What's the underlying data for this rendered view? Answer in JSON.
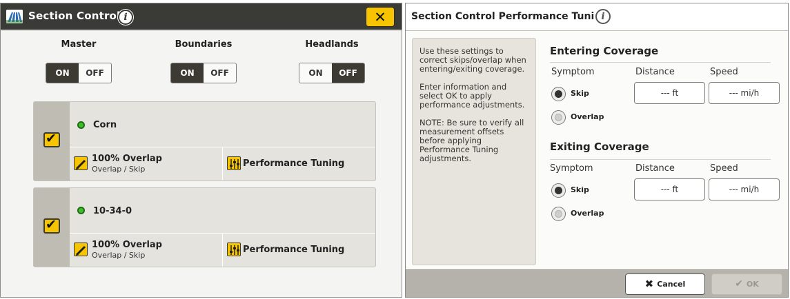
{
  "left": {
    "title": "Section Control",
    "close_icon": "close-icon",
    "toggles": [
      {
        "label": "Master",
        "on": "ON",
        "off": "OFF",
        "state": "on"
      },
      {
        "label": "Boundaries",
        "on": "ON",
        "off": "OFF",
        "state": "on"
      },
      {
        "label": "Headlands",
        "on": "ON",
        "off": "OFF",
        "state": "off"
      }
    ],
    "products": [
      {
        "name": "Corn",
        "checked": true,
        "status": "green",
        "overlap_title": "100% Overlap",
        "overlap_sub": "Overlap / Skip",
        "tuning_label": "Performance Tuning"
      },
      {
        "name": "10-34-0",
        "checked": true,
        "status": "green",
        "overlap_title": "100% Overlap",
        "overlap_sub": "Overlap / Skip",
        "tuning_label": "Performance Tuning"
      }
    ]
  },
  "right": {
    "title": "Section Control Performance Tuning",
    "help": [
      "Use these settings to correct skips/overlap when entering/exiting coverage.",
      "Enter information and select OK to apply performance adjustments.",
      "NOTE: Be sure to verify all measurement offsets before applying Performance Tuning adjustments."
    ],
    "entering": {
      "title": "Entering Coverage",
      "symptom_label": "Symptom",
      "distance_label": "Distance",
      "speed_label": "Speed",
      "skip_label": "Skip",
      "overlap_label": "Overlap",
      "selected": "Skip",
      "distance_value": "--- ft",
      "speed_value": "--- mi/h"
    },
    "exiting": {
      "title": "Exiting Coverage",
      "symptom_label": "Symptom",
      "distance_label": "Distance",
      "speed_label": "Speed",
      "skip_label": "Skip",
      "overlap_label": "Overlap",
      "selected": "Skip",
      "distance_value": "--- ft",
      "speed_value": "--- mi/h"
    },
    "cancel_label": "Cancel",
    "ok_label": "OK"
  },
  "colors": {
    "header_dark": "#3a3a37",
    "accent_yellow": "#f6c400",
    "status_green": "#3fbf2f",
    "toggle_active": "#3d3a33"
  }
}
